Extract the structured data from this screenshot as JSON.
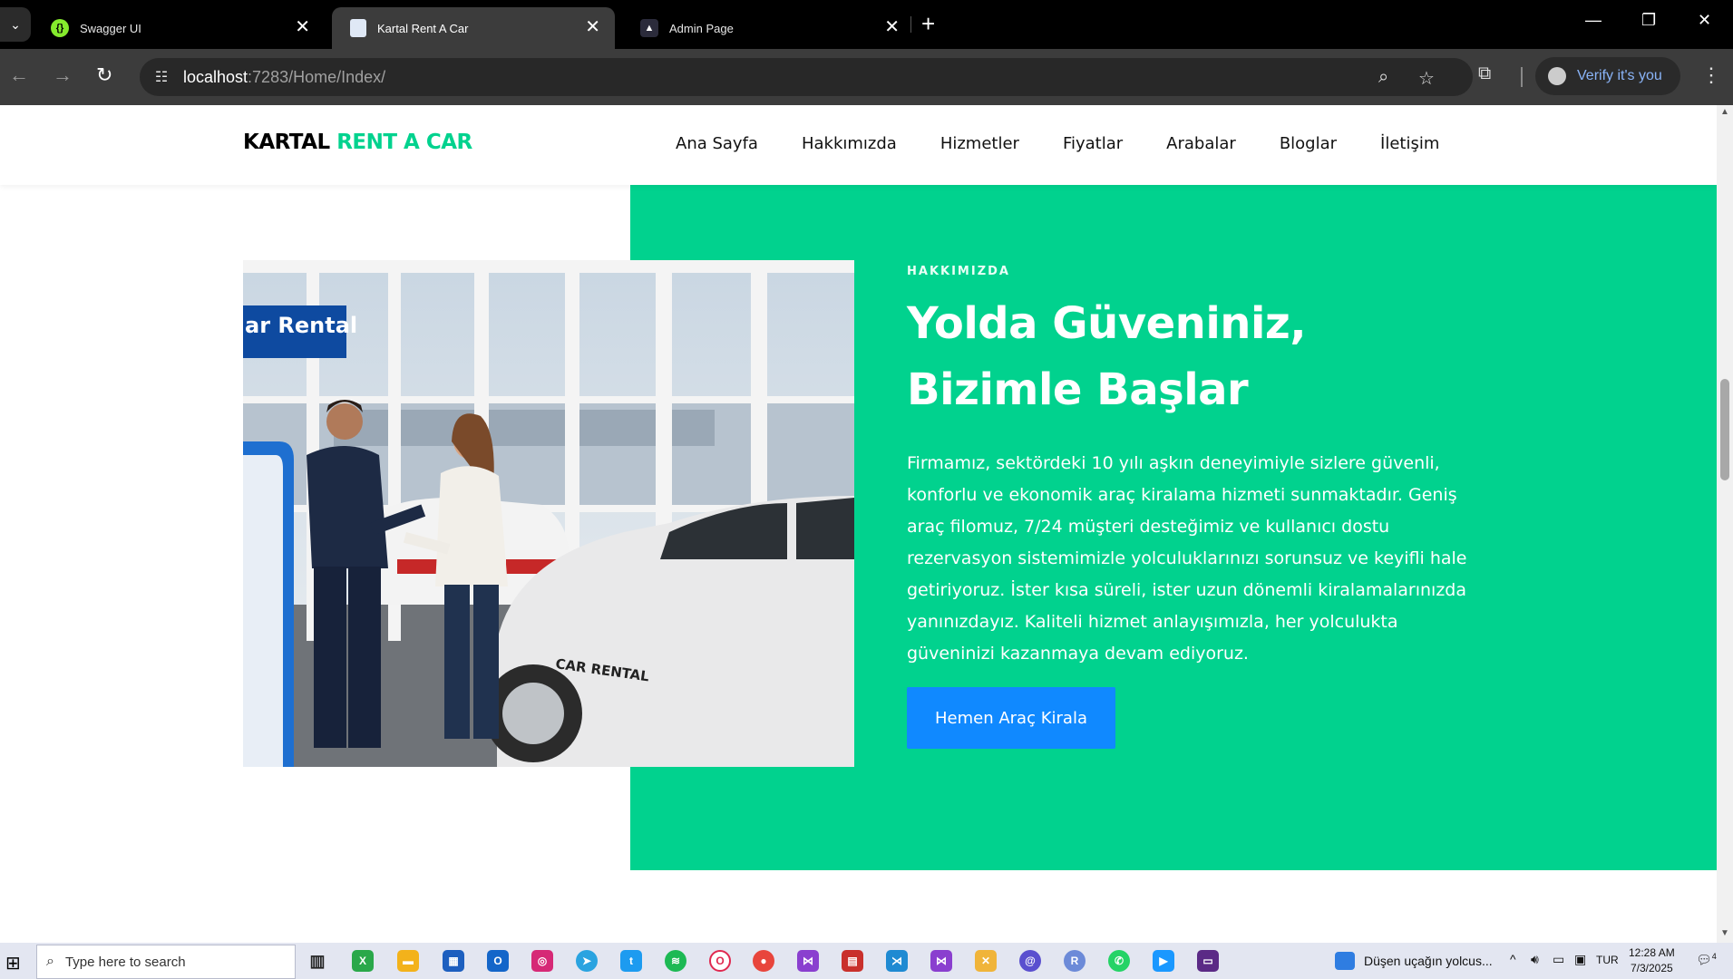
{
  "browser": {
    "tabs": [
      {
        "title": "Swagger UI",
        "icon": "swagger-icon",
        "active": false
      },
      {
        "title": "Kartal Rent A Car",
        "icon": "document-icon",
        "active": true
      },
      {
        "title": "Admin Page",
        "icon": "triangle-logo-icon",
        "active": false
      }
    ],
    "url_host": "localhost",
    "url_rest": ":7283/Home/Index/",
    "profile_label": "Verify it's you"
  },
  "site": {
    "brand_part1": "KARTAL",
    "brand_part2": "RENT A CAR",
    "nav": [
      "Ana Sayfa",
      "Hakkımızda",
      "Hizmetler",
      "Fiyatlar",
      "Arabalar",
      "Bloglar",
      "İletişim"
    ],
    "about": {
      "label": "HAKKIMIZDA",
      "title": "Yolda Güveniniz, Bizimle Başlar",
      "text": "Firmamız, sektördeki 10 yılı aşkın deneyimiyle sizlere güvenli, konforlu ve ekonomik araç kiralama hizmeti sunmaktadır. Geniş araç filomuz, 7/24 müşteri desteğimiz ve kullanıcı dostu rezervasyon sistemimizle yolculuklarınızı sorunsuz ve keyifli hale getiriyoruz. İster kısa süreli, ister uzun dönemli kiralamalarınızda yanınızdayız. Kaliteli hizmet anlayışımızla, her yolculukta güveninizi kazanmaya devam ediyoruz.",
      "cta": "Hemen Araç Kirala"
    },
    "photo": {
      "sign_text": "ar Rental",
      "car_text": "CAR RENTAL"
    },
    "colors": {
      "accent": "#01d28e",
      "button": "#1089ff"
    }
  },
  "taskbar": {
    "search_placeholder": "Type here to search",
    "news": "Düşen uçağın yolcus...",
    "language": "TUR",
    "time": "12:28 AM",
    "date": "7/3/2025",
    "notifications": "4"
  }
}
